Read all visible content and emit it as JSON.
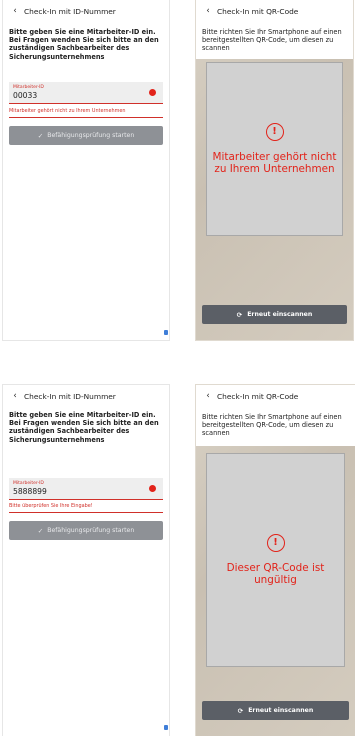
{
  "screens": [
    {
      "kind": "id",
      "header": {
        "back_icon": "‹",
        "title": "Check-In mit ID-Nummer"
      },
      "instructions": "Bitte geben Sie eine Mitarbeiter-ID ein. Bei Fragen wenden Sie sich bitte an den zuständigen Sachbearbeiter des Sicherungsunternehmens",
      "field": {
        "label": "Mitarbeiter-ID",
        "value": "00033"
      },
      "error": "Mitarbeiter gehört nicht zu Ihrem Unternehmen",
      "button": {
        "icon": "✓",
        "label": "Befähigungsprüfung starten"
      }
    },
    {
      "kind": "qr",
      "header": {
        "back_icon": "‹",
        "title": "Check-In mit QR-Code"
      },
      "instructions": "Bitte richten Sie Ihr Smartphone auf einen bereitgestellten QR-Code, um diesen zu scannen",
      "alert_icon": "!",
      "message": "Mitarbeiter gehört nicht zu Ihrem Unternehmen",
      "button": {
        "icon": "⟳",
        "label": "Erneut einscannen"
      }
    },
    {
      "kind": "id",
      "header": {
        "back_icon": "‹",
        "title": "Check-In mit ID-Nummer"
      },
      "instructions": "Bitte geben Sie eine Mitarbeiter-ID ein. Bei Fragen wenden Sie sich bitte an den zuständigen Sachbearbeiter des Sicherungsunternehmens",
      "field": {
        "label": "Mitarbeiter-ID",
        "value": "5888899"
      },
      "error": "Bitte überprüfen Sie Ihre Eingabe!",
      "button": {
        "icon": "✓",
        "label": "Befähigungsprüfung starten"
      }
    },
    {
      "kind": "qr",
      "header": {
        "back_icon": "‹",
        "title": "Check-In mit QR-Code"
      },
      "instructions": "Bitte richten Sie Ihr Smartphone auf einen bereitgestellten QR-Code, um diesen zu scannen",
      "alert_icon": "!",
      "message": "Dieser QR-Code ist ungültig",
      "button": {
        "icon": "⟳",
        "label": "Erneut einscannen"
      }
    }
  ]
}
